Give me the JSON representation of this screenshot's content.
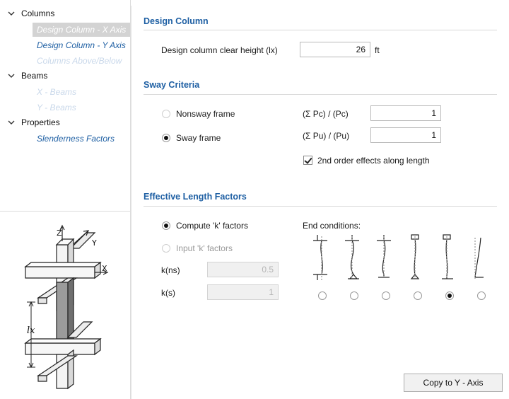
{
  "tree": {
    "columns": {
      "label": "Columns",
      "items": [
        "Design Column - X Axis",
        "Design Column - Y Axis",
        "Columns Above/Below"
      ]
    },
    "beams": {
      "label": "Beams",
      "items": [
        "X - Beams",
        "Y - Beams"
      ]
    },
    "properties": {
      "label": "Properties",
      "items": [
        "Slenderness Factors"
      ]
    }
  },
  "diagram": {
    "z_label": "Z",
    "y_label": "Y",
    "x_label": "X",
    "length_label": "lx"
  },
  "design_column": {
    "title": "Design Column",
    "clear_height_label": "Design column clear height (lx)",
    "clear_height_value": "26",
    "clear_height_unit": "ft"
  },
  "sway": {
    "title": "Sway Criteria",
    "nonsway_label": "Nonsway frame",
    "sway_label": "Sway frame",
    "sway_selected": true,
    "pc_label": "(Σ Pc) / (Pc)",
    "pc_value": "1",
    "pu_label": "(Σ Pu) / (Pu)",
    "pu_value": "1",
    "second_order_label": "2nd order effects along length",
    "second_order_checked": true
  },
  "elf": {
    "title": "Effective Length Factors",
    "compute_label": "Compute 'k' factors",
    "input_label": "Input 'k' factors",
    "compute_selected": true,
    "kns_label": "k(ns)",
    "kns_value": "0.5",
    "ks_label": "k(s)",
    "ks_value": "1",
    "end_conditions_label": "End conditions:",
    "end_condition_selected_index": 4
  },
  "footer": {
    "copy_button": "Copy to Y - Axis"
  },
  "colors": {
    "accent": "#1e5fa3",
    "disabled_link": "#c9d8ea",
    "selected_bg": "#d3d3d3"
  }
}
